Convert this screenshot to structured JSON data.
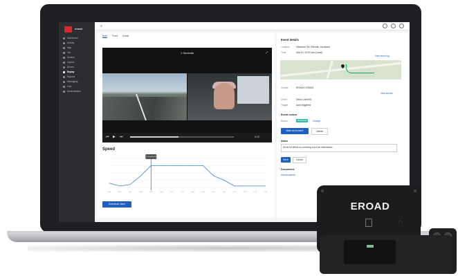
{
  "app": {
    "brand": "eroad"
  },
  "sidebar": {
    "items": [
      {
        "label": "Dashboard"
      },
      {
        "label": "Activity"
      },
      {
        "label": "Map"
      },
      {
        "label": "Tax"
      },
      {
        "label": "Service"
      },
      {
        "label": "Inspect"
      },
      {
        "label": "Drivers"
      },
      {
        "label": "Replay"
      },
      {
        "label": "Reports"
      },
      {
        "label": "Messaging"
      },
      {
        "label": "Fuel"
      },
      {
        "label": "Administration"
      }
    ]
  },
  "tabs": [
    {
      "label": "Both"
    },
    {
      "label": "Front"
    },
    {
      "label": "Driver"
    }
  ],
  "video": {
    "title": "1 Seconds",
    "time": "0:15"
  },
  "speed": {
    "title": "Speed",
    "marker": "1 second event",
    "download_label": "Download video"
  },
  "chart_data": {
    "type": "line",
    "title": "Speed",
    "x": [
      "0:00",
      "0:01",
      "0:02",
      "0:03",
      "0:04",
      "0:05",
      "0:06",
      "0:07",
      "0:08",
      "0:09",
      "0:10",
      "0:11",
      "0:12",
      "0:13",
      "0:14",
      "0:15"
    ],
    "values": [
      3,
      1,
      2,
      8,
      15,
      15,
      15,
      15,
      15,
      15,
      8,
      5,
      1,
      1,
      1,
      1
    ],
    "ylim": [
      0,
      20
    ]
  },
  "event": {
    "heading": "Event details",
    "location_label": "Location",
    "location_value": "Hillsmere Rd, Ellerslie, Auckland",
    "time_label": "Time",
    "time_value": "Mar 10, 10:00 am (Local)",
    "view_link": "View event log",
    "vehicle_label": "Vehicle",
    "vehicle_value": "ER0001 ER0001",
    "service_link": "View service",
    "driver_label": "Driver",
    "driver_value": "Demo User001",
    "trigger_label": "Trigger",
    "trigger_value": "Auto triggered"
  },
  "review": {
    "heading": "Event review",
    "status_label": "Status",
    "status_badge": "Reviewed",
    "change_link": "Change",
    "mark_button": "Mark as incident",
    "delete_button": "Delete",
    "notes_label": "Notes",
    "notes_value": "Driver hit debris on cornering out of an intersection",
    "save_button": "Save",
    "cancel_button": "Cancel",
    "documents_label": "Documents",
    "add_document_link": "Add document"
  },
  "device": {
    "brand": "EROAD"
  },
  "colors": {
    "accent": "#1f5fbf",
    "brand": "#d9272e",
    "sidebar": "#2b2d31"
  }
}
